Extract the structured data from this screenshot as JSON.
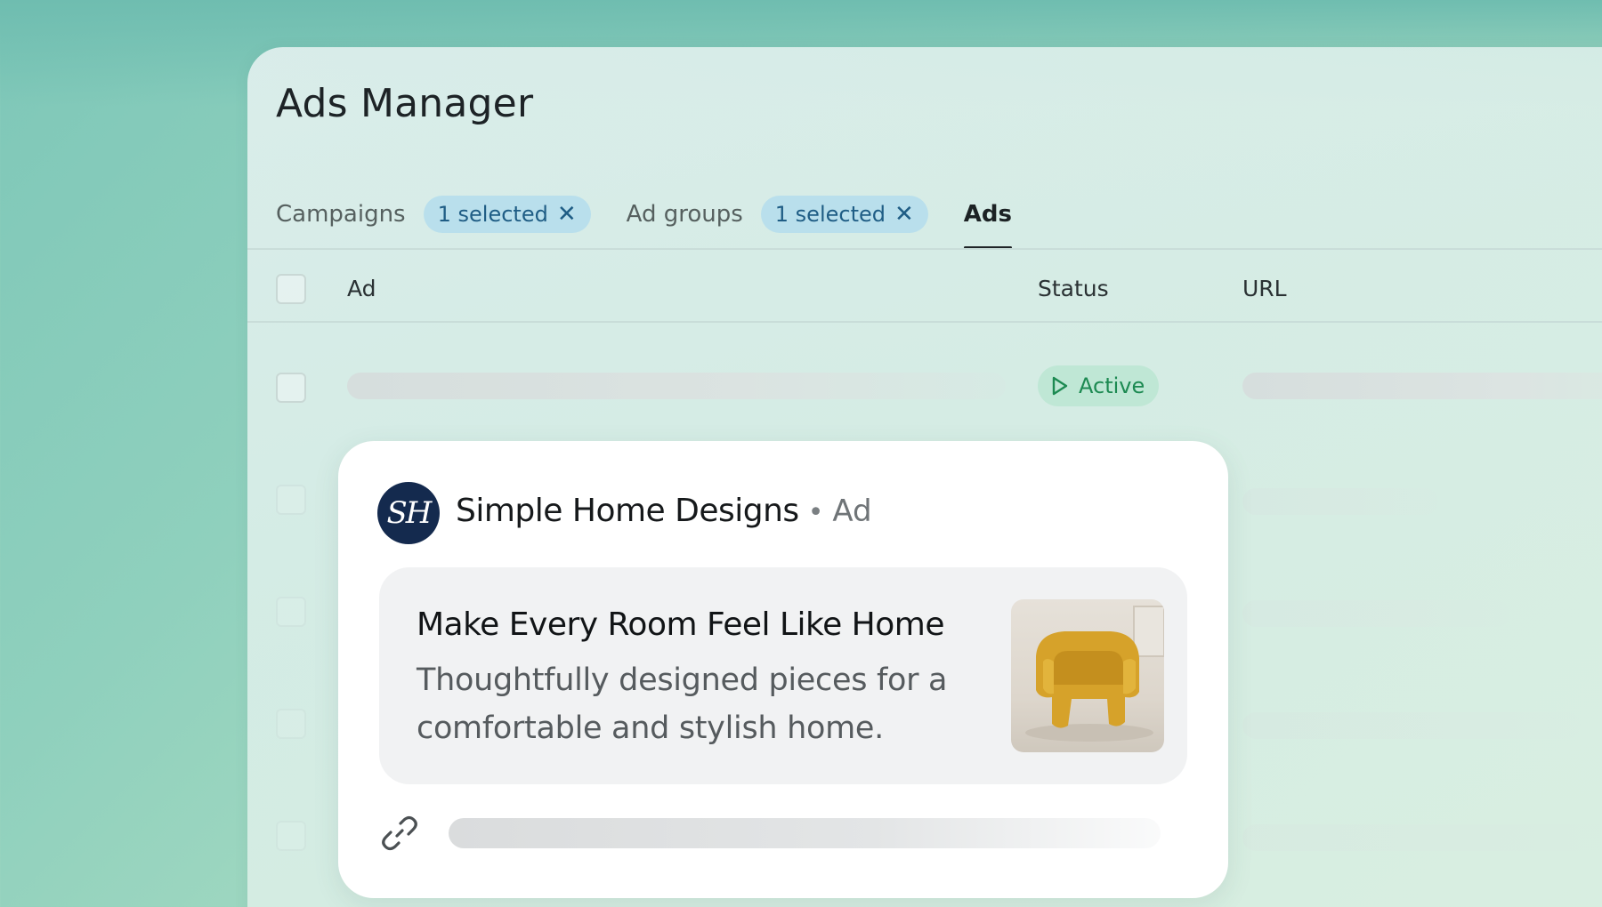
{
  "app": {
    "title": "Ads Manager"
  },
  "tabs": {
    "campaigns": {
      "label": "Campaigns",
      "chip": "1 selected"
    },
    "ad_groups": {
      "label": "Ad groups",
      "chip": "1 selected"
    },
    "ads": {
      "label": "Ads"
    }
  },
  "table": {
    "columns": [
      "Ad",
      "Status",
      "URL"
    ],
    "rows": [
      {
        "status": "Active"
      }
    ]
  },
  "ad_preview": {
    "avatar_initials": "SH",
    "brand_name": "Simple Home Designs",
    "separator": "•",
    "ad_tag": "Ad",
    "headline": "Make Every Room Feel Like Home",
    "body": "Thoughtfully designed pieces for a comfortable and stylish home."
  },
  "colors": {
    "chip_bg": "#b9dfec",
    "chip_text": "#1f5d85",
    "status_bg": "#bfe7d5",
    "status_text": "#1d8a52",
    "avatar_bg": "#142a4e"
  },
  "icons": {
    "chip_remove": "close-icon",
    "status": "play-icon",
    "url": "link-icon"
  }
}
